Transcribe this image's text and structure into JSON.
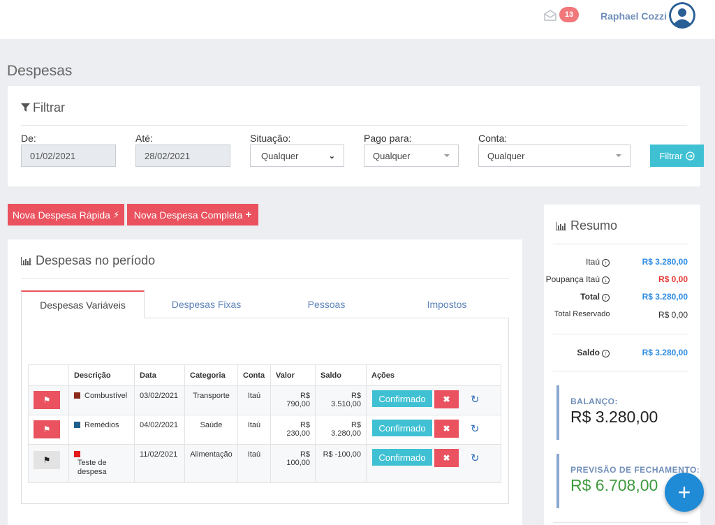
{
  "header": {
    "notif_count": "13",
    "user_name": "Raphael Cozzi"
  },
  "page_title": "Despesas",
  "filter": {
    "title": "Filtrar",
    "de_label": "De:",
    "de_value": "01/02/2021",
    "ate_label": "Até:",
    "ate_value": "28/02/2021",
    "situacao_label": "Situação:",
    "situacao_value": "Qualquer",
    "pago_label": "Pago para:",
    "pago_value": "Qualquer",
    "conta_label": "Conta:",
    "conta_value": "Qualquer",
    "button": "Filtrar"
  },
  "actions": {
    "rapida": "Nova Despesa Rápida",
    "completa": "Nova Despesa Completa"
  },
  "expenses": {
    "title": "Despesas no período",
    "tabs": [
      "Despesas Variáveis",
      "Despesas Fixas",
      "Pessoas",
      "Impostos"
    ],
    "columns": [
      "Descrição",
      "Data",
      "Categoria",
      "Conta",
      "Valor",
      "Saldo",
      "Ações"
    ],
    "rows": [
      {
        "flag": "red",
        "color": "#8b2a1a",
        "desc": "Combustível",
        "data": "03/02/2021",
        "categoria": "Transporte",
        "conta": "Itaú",
        "valor": "R$ 790,00",
        "saldo": "R$ 3.510,00",
        "status": "Confirmado"
      },
      {
        "flag": "red",
        "color": "#1f5f8b",
        "desc": "Remédios",
        "data": "04/02/2021",
        "categoria": "Saúde",
        "conta": "Itaú",
        "valor": "R$ 230,00",
        "saldo": "R$ 3.280,00",
        "status": "Confirmado"
      },
      {
        "flag": "grey",
        "color": "#e31b1b",
        "desc": "Teste de despesa",
        "data": "11/02/2021",
        "categoria": "Alimentação",
        "conta": "Itaú",
        "valor": "R$ 100,00",
        "saldo": "R$ -100,00",
        "status": "Confirmado"
      }
    ]
  },
  "summary": {
    "title": "Resumo",
    "itau_label": "Itaú",
    "itau_value": "R$ 3.280,00",
    "poupanca_label": "Poupança Itaú",
    "poupanca_value": "R$ 0,00",
    "total_label": "Total",
    "total_value": "R$ 3.280,00",
    "reservado_label": "Total Reservado",
    "reservado_value": "R$ 0,00",
    "saldo_label": "Saldo",
    "saldo_value": "R$ 3.280,00",
    "balanco_label": "BALANÇO:",
    "balanco_value": "R$ 3.280,00",
    "previsao_label": "PREVISÃO DE FECHAMENTO:",
    "previsao_value": "R$ 6.708,00"
  },
  "colors": {
    "accent_red": "#e9525e",
    "accent_cyan": "#3fc1d3",
    "link_blue": "#2f8de4"
  }
}
